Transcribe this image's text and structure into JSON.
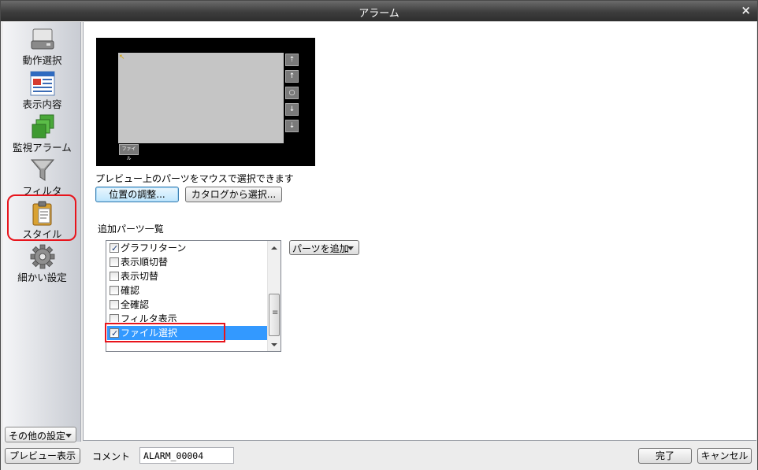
{
  "window": {
    "title": "アラーム",
    "close": "×"
  },
  "sidebar": {
    "items": [
      {
        "label": "動作選択",
        "icon": "drive-icon"
      },
      {
        "label": "表示内容",
        "icon": "document-list-icon"
      },
      {
        "label": "監視アラーム",
        "icon": "green-stack-icon"
      },
      {
        "label": "フィルタ",
        "icon": "funnel-icon"
      },
      {
        "label": "スタイル",
        "icon": "clipboard-icon"
      },
      {
        "label": "細かい設定",
        "icon": "gear-icon"
      }
    ],
    "other_settings": "その他の設定"
  },
  "preview": {
    "caption": "プレビュー上のパーツをマウスで選択できます",
    "file_button": "ファイル",
    "side_buttons": [
      "⇡",
      "↑",
      "○",
      "↓",
      "⇣"
    ]
  },
  "buttons": {
    "position_adjust": "位置の調整...",
    "select_from_catalog": "カタログから選択..."
  },
  "parts": {
    "label": "追加パーツ一覧",
    "add_button": "パーツを追加",
    "items": [
      {
        "label": "グラフリターン",
        "checked": true
      },
      {
        "label": "表示順切替",
        "checked": false
      },
      {
        "label": "表示切替",
        "checked": false
      },
      {
        "label": "確認",
        "checked": false
      },
      {
        "label": "全確認",
        "checked": false
      },
      {
        "label": "フィルタ表示",
        "checked": false
      },
      {
        "label": "ファイル選択",
        "checked": true
      }
    ]
  },
  "footer": {
    "preview_button": "プレビュー表示",
    "comment_label": "コメント",
    "comment_value": "ALARM_00004",
    "ok_button": "完了",
    "cancel_button": "キャンセル"
  }
}
